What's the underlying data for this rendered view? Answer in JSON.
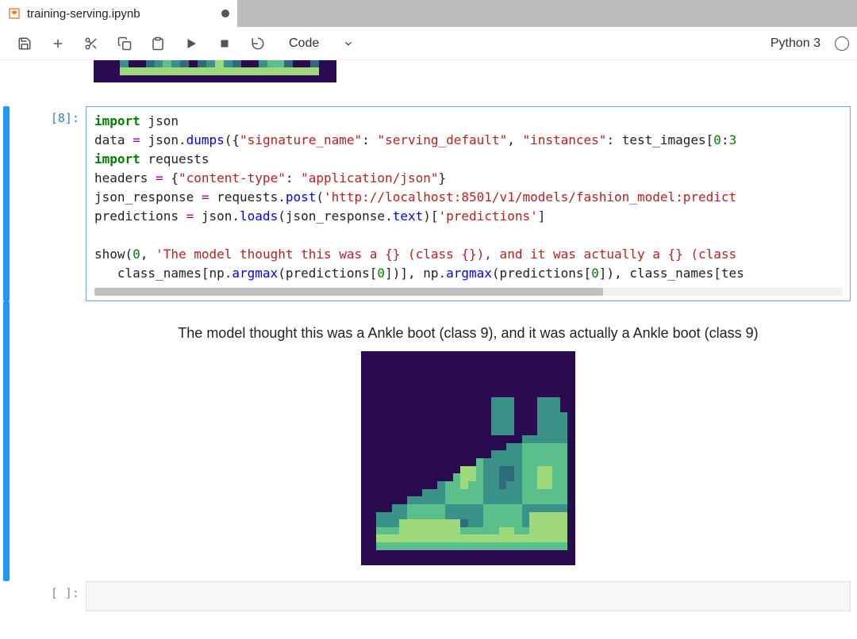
{
  "tab": {
    "title": "training-serving.ipynb",
    "dirty": true
  },
  "toolbar": {
    "celltype": "Code",
    "kernel": "Python 3"
  },
  "cell8": {
    "prompt": "[8]:",
    "code": {
      "l1": {
        "a": "import",
        "b": " json"
      },
      "l2": {
        "a": "data ",
        "op": "=",
        "b": " json.",
        "fn": "dumps",
        "c": "({",
        "s1": "\"signature_name\"",
        "d": ": ",
        "s2": "\"serving_default\"",
        "e": ", ",
        "s3": "\"instances\"",
        "f": ": test_images[",
        "n1": "0",
        "g": ":",
        "n2": "3"
      },
      "l3": {
        "a": "import",
        "b": " requests"
      },
      "l4": {
        "a": "headers ",
        "op": "=",
        "b": " {",
        "s1": "\"content-type\"",
        "c": ": ",
        "s2": "\"application/json\"",
        "d": "}"
      },
      "l5": {
        "a": "json_response ",
        "op": "=",
        "b": " requests.",
        "fn": "post",
        "c": "(",
        "s1": "'http://localhost:8501/v1/models/fashion_model:predict"
      },
      "l6": {
        "a": "predictions ",
        "op": "=",
        "b": " json.",
        "fn": "loads",
        "c": "(json_response.",
        "fn2": "text",
        "d": ")[",
        "s1": "'predictions'",
        "e": "]"
      },
      "l8": {
        "a": "show(",
        "n1": "0",
        "b": ", ",
        "s1": "'The model thought this was a {} (class {}), and it was actually a {} (class"
      },
      "l9": {
        "a": "   class_names[np.",
        "fn": "argmax",
        "b": "(predictions[",
        "n1": "0",
        "c": "])], np.",
        "fn2": "argmax",
        "d": "(predictions[",
        "n2": "0",
        "e": "]), class_names[tes"
      }
    }
  },
  "output": {
    "text": "The model thought this was a Ankle boot (class 9), and it was actually a Ankle boot (class 9)"
  },
  "emptycell": {
    "prompt": "[ ]:"
  },
  "colors": {
    "bg": "#2b0b50",
    "boot_palette": [
      "#2b0b50",
      "#2f6b7a",
      "#3a9188",
      "#5bbf8b",
      "#9dd97a",
      "#e8e337"
    ]
  }
}
